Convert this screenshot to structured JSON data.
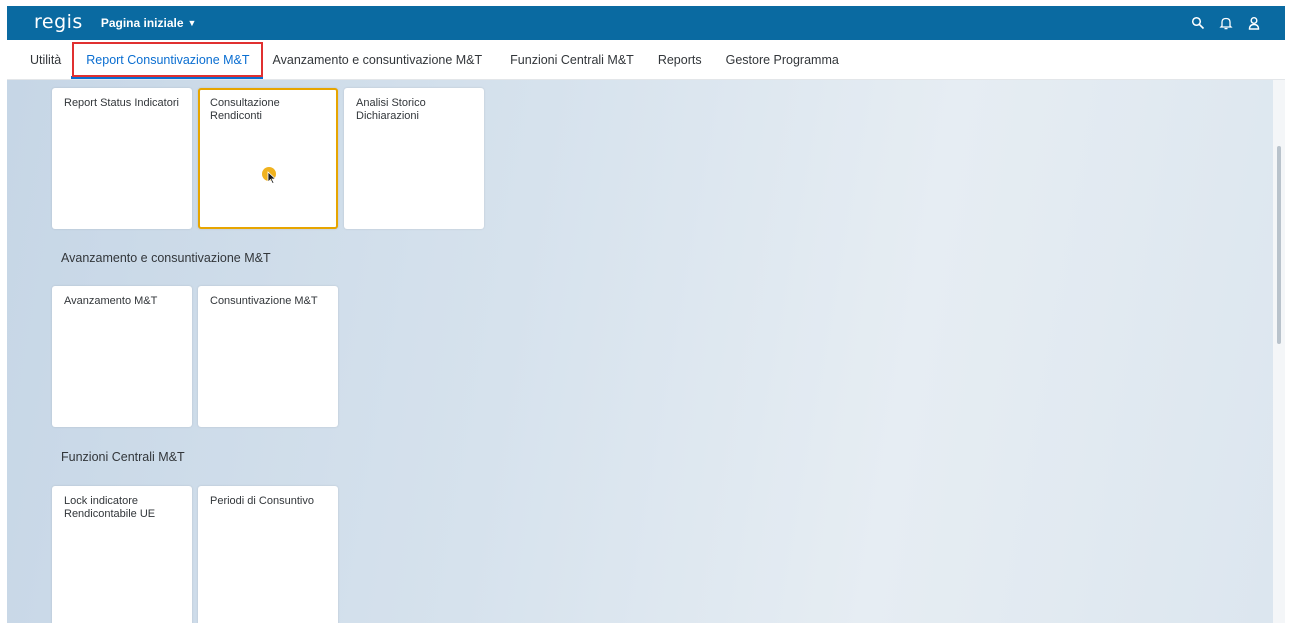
{
  "shellbar": {
    "logo": "regis",
    "home_menu": "Pagina iniziale"
  },
  "tabs": [
    {
      "label": "Utilità"
    },
    {
      "label": "Report Consuntivazione M&T"
    },
    {
      "label": "Avanzamento e consuntivazione M&T"
    },
    {
      "label": "Funzioni Centrali M&T"
    },
    {
      "label": "Reports"
    },
    {
      "label": "Gestore Programma"
    }
  ],
  "active_tab": "Report Consuntivazione M&T",
  "groups": [
    {
      "title": "",
      "tiles": [
        {
          "title": "Report Status Indicatori"
        },
        {
          "title": "Consultazione Rendiconti"
        },
        {
          "title": "Analisi Storico Dichiarazioni"
        }
      ]
    },
    {
      "title": "Avanzamento e consuntivazione M&T",
      "tiles": [
        {
          "title": "Avanzamento M&T"
        },
        {
          "title": "Consuntivazione M&T"
        }
      ]
    },
    {
      "title": "Funzioni Centrali M&T",
      "tiles": [
        {
          "title": "Lock indicatore Rendicontabile UE"
        },
        {
          "title": "Periodi di Consuntivo"
        }
      ]
    }
  ],
  "icons": {
    "search": "search-icon",
    "notifications": "bell-icon",
    "user": "user-icon"
  },
  "colors": {
    "shellbar": "#0a6aa1",
    "active_tab": "#0a6ed1",
    "highlight_box": "#e03030",
    "focus_border": "#e7a500"
  }
}
